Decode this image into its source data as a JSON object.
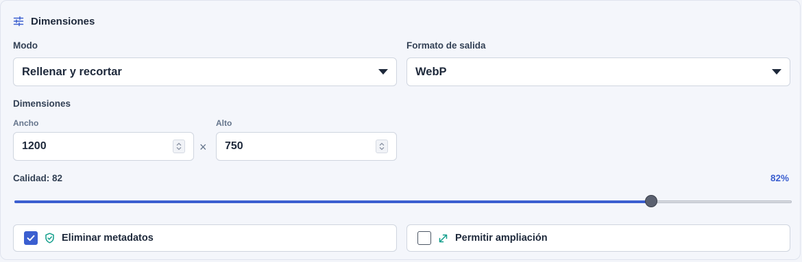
{
  "section": {
    "title": "Dimensiones",
    "icon": "sliders-icon"
  },
  "mode": {
    "label": "Modo",
    "value": "Rellenar y recortar"
  },
  "format": {
    "label": "Formato de salida",
    "value": "WebP"
  },
  "dimensions": {
    "label": "Dimensiones",
    "width": {
      "label": "Ancho",
      "value": "1200"
    },
    "separator": "×",
    "height": {
      "label": "Alto",
      "value": "750"
    }
  },
  "quality": {
    "label": "Calidad: 82",
    "percent_text": "82%",
    "level": 0.82
  },
  "options": {
    "strip_metadata": {
      "label": "Eliminar metadatos",
      "checked": true,
      "icon": "shield-check-icon"
    },
    "allow_upscale": {
      "label": "Permitir ampliación",
      "checked": false,
      "icon": "expand-arrows-icon"
    }
  },
  "colors": {
    "accent": "#3b5fd0",
    "teal_icon": "#0f9d8a"
  }
}
